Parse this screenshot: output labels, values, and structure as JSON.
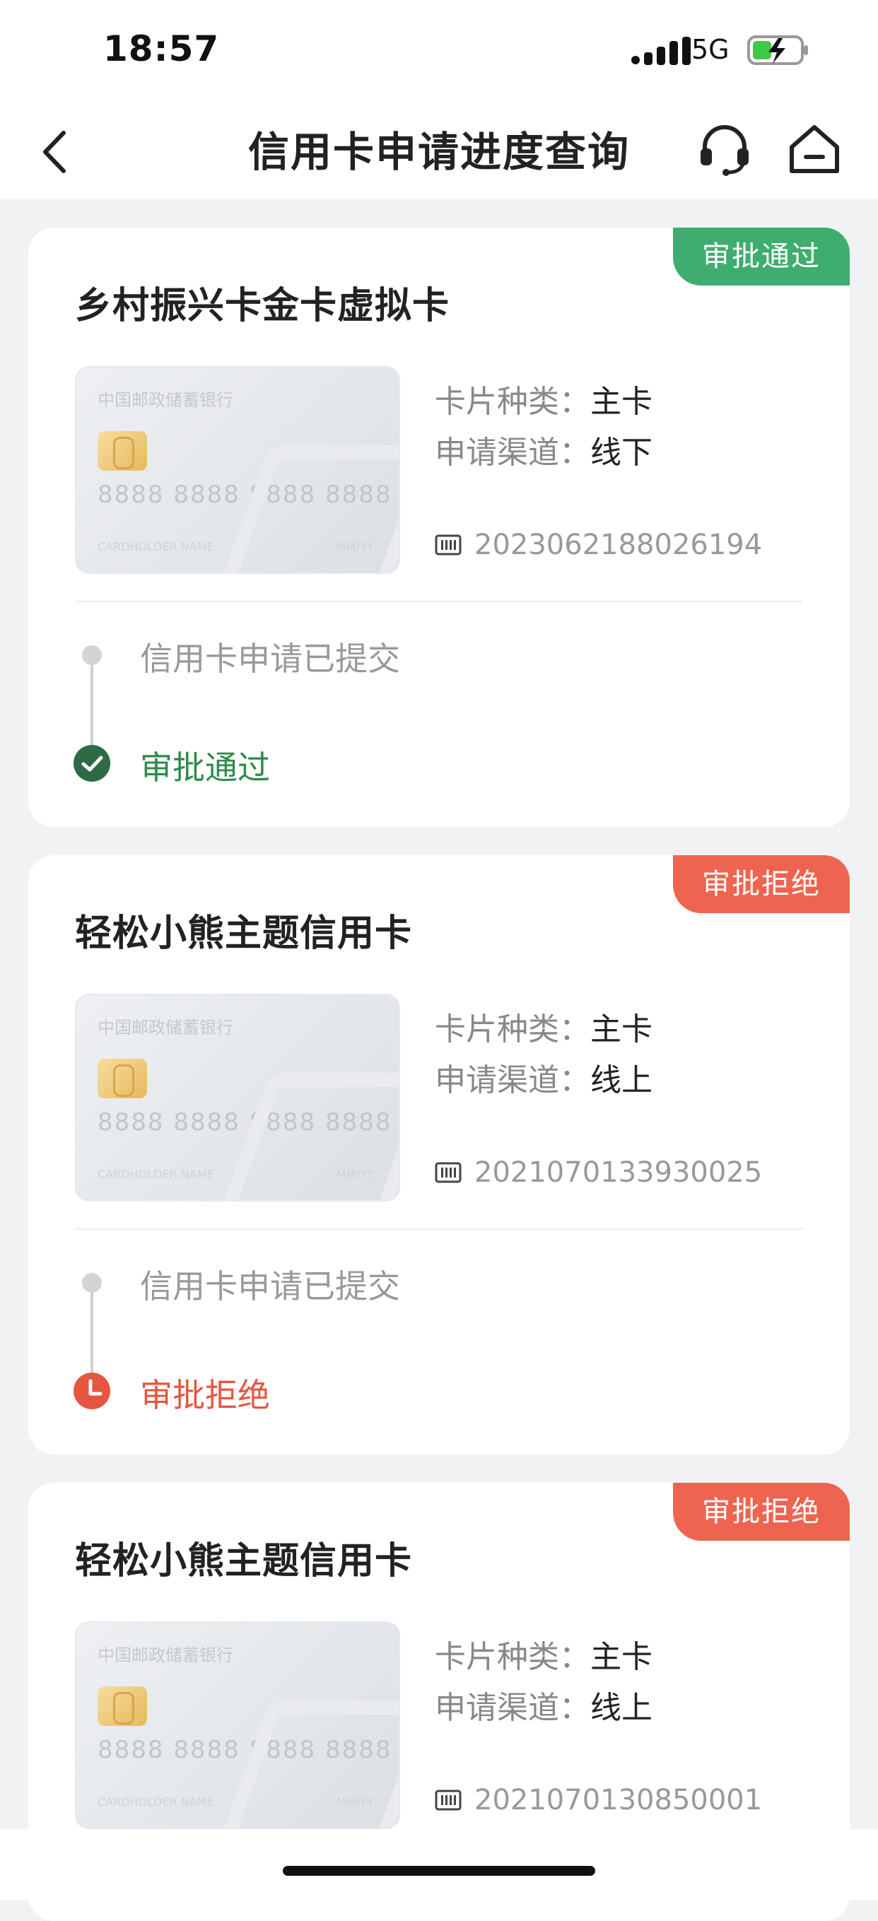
{
  "status_bar": {
    "time": "18:57",
    "network": "5G"
  },
  "nav": {
    "title": "信用卡申请进度查询"
  },
  "card_preview": {
    "bank": "中国邮政储蓄银行",
    "number": "8888 8888 8888 8888",
    "holder": "CARDHOLDER NAME",
    "expiry": "MM/YY"
  },
  "labels": {
    "card_type": "卡片种类：",
    "channel": "申请渠道："
  },
  "applications": [
    {
      "status": "审批通过",
      "title": "乡村振兴卡金卡虚拟卡",
      "card_type": "主卡",
      "channel": "线下",
      "serial": "2023062188026194",
      "step1": "信用卡申请已提交",
      "step2": "审批通过"
    },
    {
      "status": "审批拒绝",
      "title": "轻松小熊主题信用卡",
      "card_type": "主卡",
      "channel": "线上",
      "serial": "2021070133930025",
      "step1": "信用卡申请已提交",
      "step2": "审批拒绝"
    },
    {
      "status": "审批拒绝",
      "title": "轻松小熊主题信用卡",
      "card_type": "主卡",
      "channel": "线上",
      "serial": "2021070130850001"
    }
  ],
  "colors": {
    "approved": "#3ead6f",
    "rejected": "#ee6450",
    "approved_text": "#2f8a4a"
  }
}
